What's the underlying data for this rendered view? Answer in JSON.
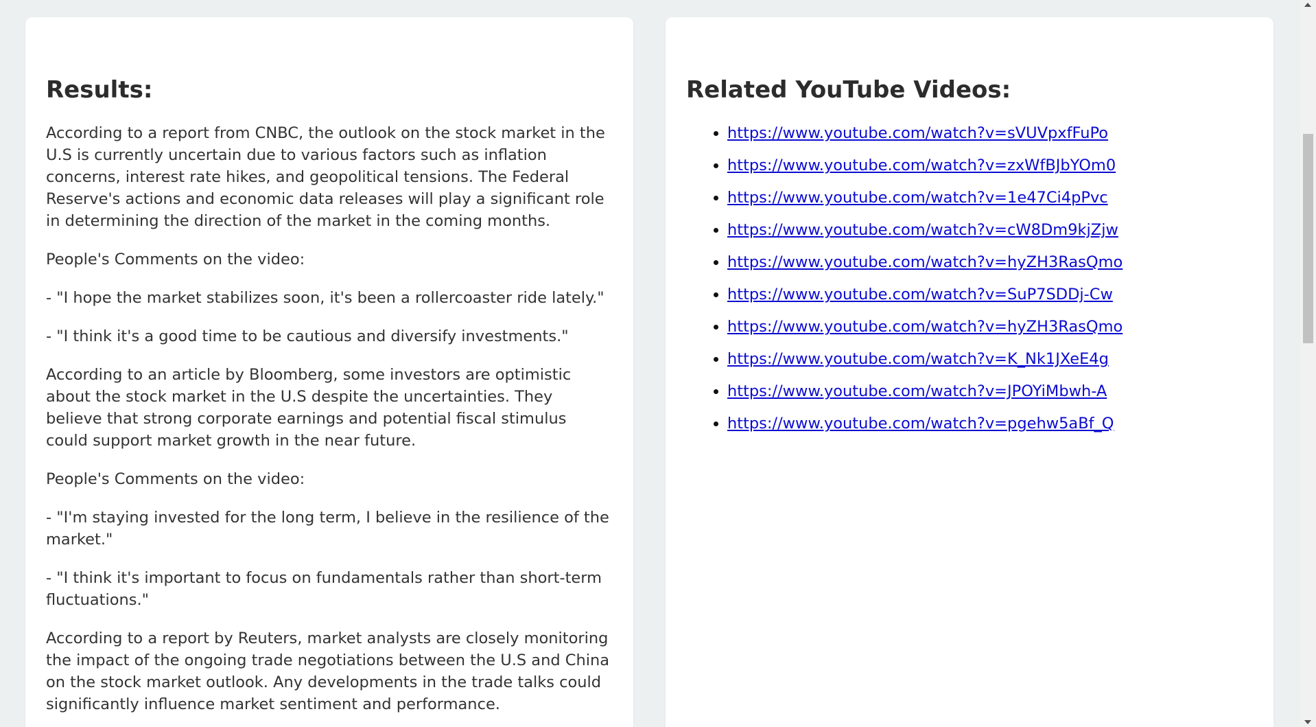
{
  "results": {
    "heading": "Results:",
    "paragraphs": [
      "According to a report from CNBC, the outlook on the stock market in the U.S is currently uncertain due to various factors such as inflation concerns, interest rate hikes, and geopolitical tensions. The Federal Reserve's actions and economic data releases will play a significant role in determining the direction of the market in the coming months.",
      "People's Comments on the video:",
      "- \"I hope the market stabilizes soon, it's been a rollercoaster ride lately.\"",
      "- \"I think it's a good time to be cautious and diversify investments.\"",
      "According to an article by Bloomberg, some investors are optimistic about the stock market in the U.S despite the uncertainties. They believe that strong corporate earnings and potential fiscal stimulus could support market growth in the near future.",
      "People's Comments on the video:",
      "- \"I'm staying invested for the long term, I believe in the resilience of the market.\"",
      "- \"I think it's important to focus on fundamentals rather than short-term fluctuations.\"",
      "According to a report by Reuters, market analysts are closely monitoring the impact of the ongoing trade negotiations between the U.S and China on the stock market outlook. Any developments in the trade talks could significantly influence market sentiment and performance."
    ]
  },
  "videos": {
    "heading": "Related YouTube Videos:",
    "links": [
      "https://www.youtube.com/watch?v=sVUVpxfFuPo",
      "https://www.youtube.com/watch?v=zxWfBJbYOm0",
      "https://www.youtube.com/watch?v=1e47Ci4pPvc",
      "https://www.youtube.com/watch?v=cW8Dm9kjZjw",
      "https://www.youtube.com/watch?v=hyZH3RasQmo",
      "https://www.youtube.com/watch?v=SuP7SDDj-Cw",
      "https://www.youtube.com/watch?v=hyZH3RasQmo",
      "https://www.youtube.com/watch?v=K_Nk1JXeE4g",
      "https://www.youtube.com/watch?v=JPOYiMbwh-A",
      "https://www.youtube.com/watch?v=pgehw5aBf_Q"
    ]
  },
  "colors": {
    "background": "#ecf0f1",
    "card": "#ffffff",
    "link": "#0b0bd1",
    "text": "#333333"
  }
}
